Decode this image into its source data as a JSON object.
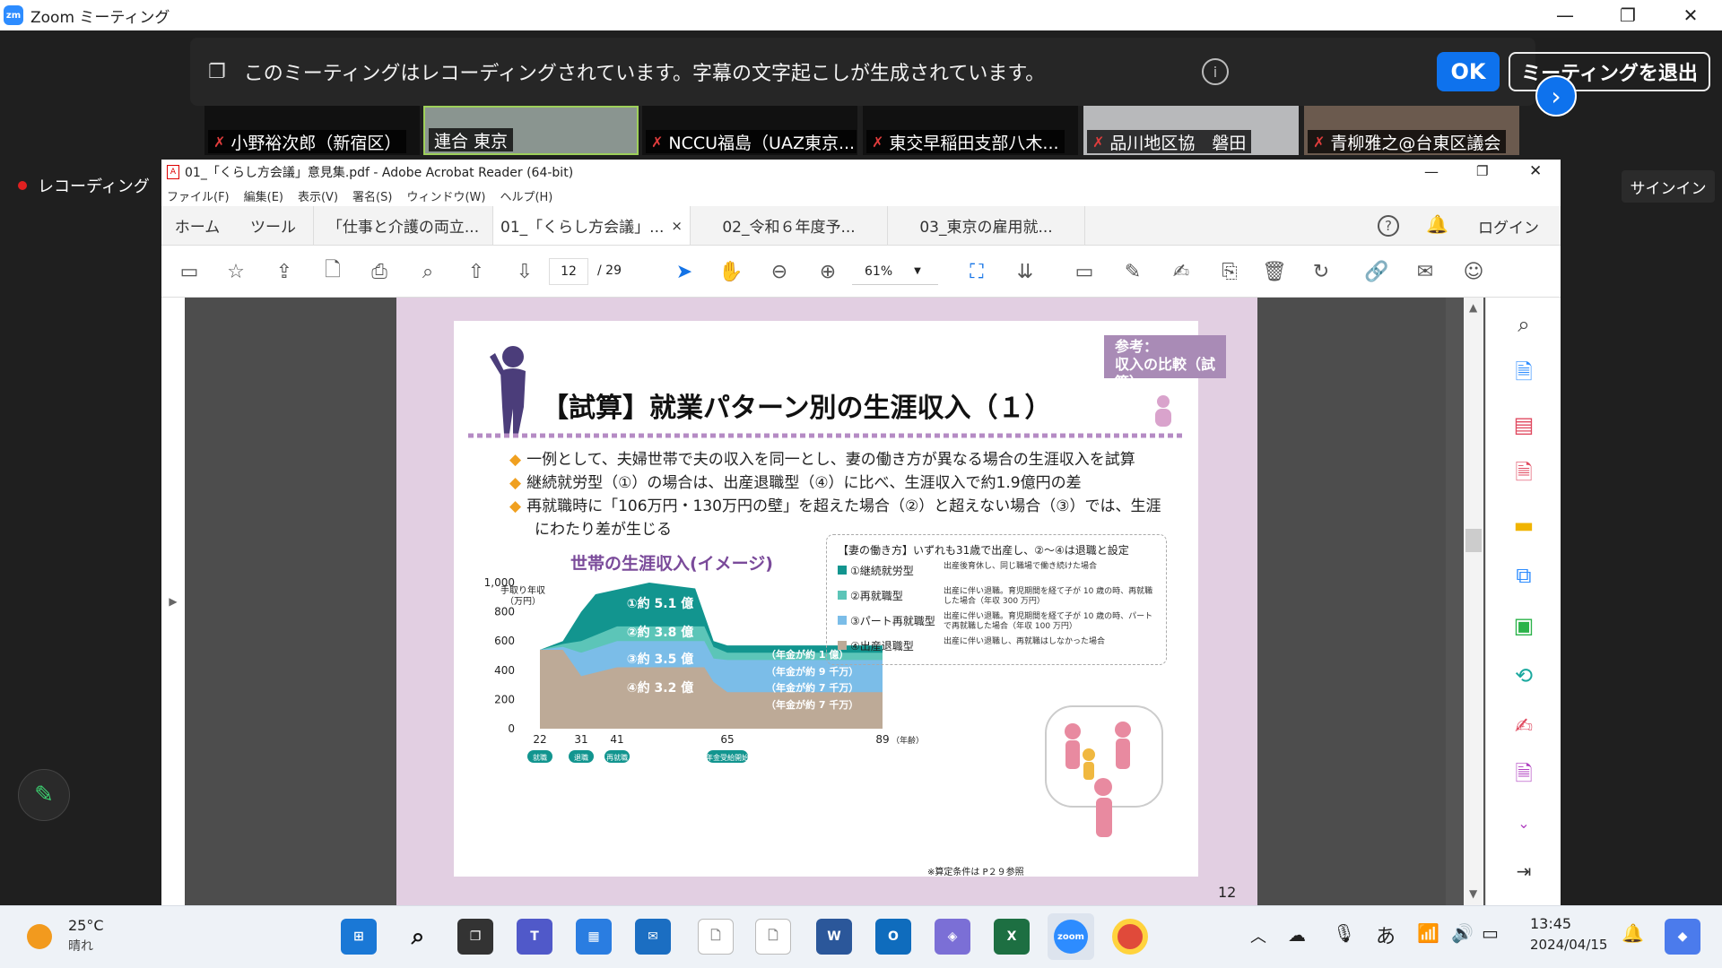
{
  "zoom": {
    "title": "Zoom ミーティング",
    "banner": "このミーティングはレコーディングされています。字幕の文字起こしが生成されています。",
    "ok": "OK",
    "leave": "ミーティングを退出",
    "recording": "レコーディング",
    "signin": "サインイン",
    "participants": [
      "小野裕次郎（新宿区）",
      "連合 東京",
      "NCCU福島（UAZ東京...",
      "東交早稲田支部八木...",
      "品川地区協　磐田",
      "青柳雅之@台東区議会"
    ]
  },
  "acrobat": {
    "title": "01_「くらし方会議」意見集.pdf - Adobe Acrobat Reader (64-bit)",
    "menu": [
      "ファイル(F)",
      "編集(E)",
      "表示(V)",
      "署名(S)",
      "ウィンドウ(W)",
      "ヘルプ(H)"
    ],
    "home": "ホーム",
    "tools": "ツール",
    "tabs": [
      "「仕事と介護の両立...",
      "01_「くらし方会議」...",
      "02_令和６年度予...",
      "03_東京の雇用就..."
    ],
    "close_tab": "×",
    "login": "ログイン",
    "page_current": "12",
    "page_total": "/ 29",
    "zoom": "61%"
  },
  "slide": {
    "tag_line1": "参考：",
    "tag_line2": "収入の比較（試算）",
    "title": "【試算】就業パターン別の生涯収入（１）",
    "bullets": [
      "一例として、夫婦世帯で夫の収入を同一とし、妻の働き方が異なる場合の生涯収入を試算",
      "継続就労型（①）の場合は、出産退職型（④）に比べ、生涯収入で約1.9億円の差",
      "再就職時に「106万円・130万円の壁」を超えた場合（②）と超えない場合（③）では、生涯",
      "にわたり差が生じる"
    ],
    "chart_title": "世帯の生涯収入(イメージ)",
    "ylabel_1": "手取り年収",
    "ylabel_2": "（万円）",
    "yticks": [
      "1,000",
      "800",
      "600",
      "400",
      "200",
      "0"
    ],
    "xticks": [
      "22",
      "31",
      "41",
      "65",
      "89"
    ],
    "x_unit": "（年齢）",
    "stage_labels": [
      "就職",
      "退職",
      "再就職",
      "年金受給開始"
    ],
    "band_labels": [
      "①約 5.1 億",
      "②約 3.8 億",
      "③約 3.5 億",
      "④約 3.2 億"
    ],
    "pension_labels": [
      "（年金が約 1 億）",
      "（年金が約 9 千万）",
      "（年金が約 7 千万）",
      "（年金が約 7 千万）"
    ],
    "legend_head": "【妻の働き方】いずれも31歳で出産し、②〜④は退職と設定",
    "legend": [
      {
        "name": "①継続就労型",
        "desc": "出産後育休し、同じ職場で働き続けた場合",
        "color": "#12958f"
      },
      {
        "name": "②再就職型",
        "desc": "出産に伴い退職。育児期間を経て子が 10 歳の時、再就職した場合（年収 300 万円）",
        "color": "#5cc5b8"
      },
      {
        "name": "③パート再就職型",
        "desc": "出産に伴い退職。育児期間を経て子が 10 歳の時、パートで再就職した場合（年収 100 万円）",
        "color": "#7bbde8"
      },
      {
        "name": "④出産退職型",
        "desc": "出産に伴い退職し、再就職はしなかった場合",
        "color": "#bdaa97"
      }
    ],
    "footnote": "※算定条件は P２９参照",
    "page_num": "12"
  },
  "taskbar": {
    "temp": "25°C",
    "weather": "晴れ",
    "time": "13:45",
    "date": "2024/04/15",
    "ime": "あ"
  }
}
